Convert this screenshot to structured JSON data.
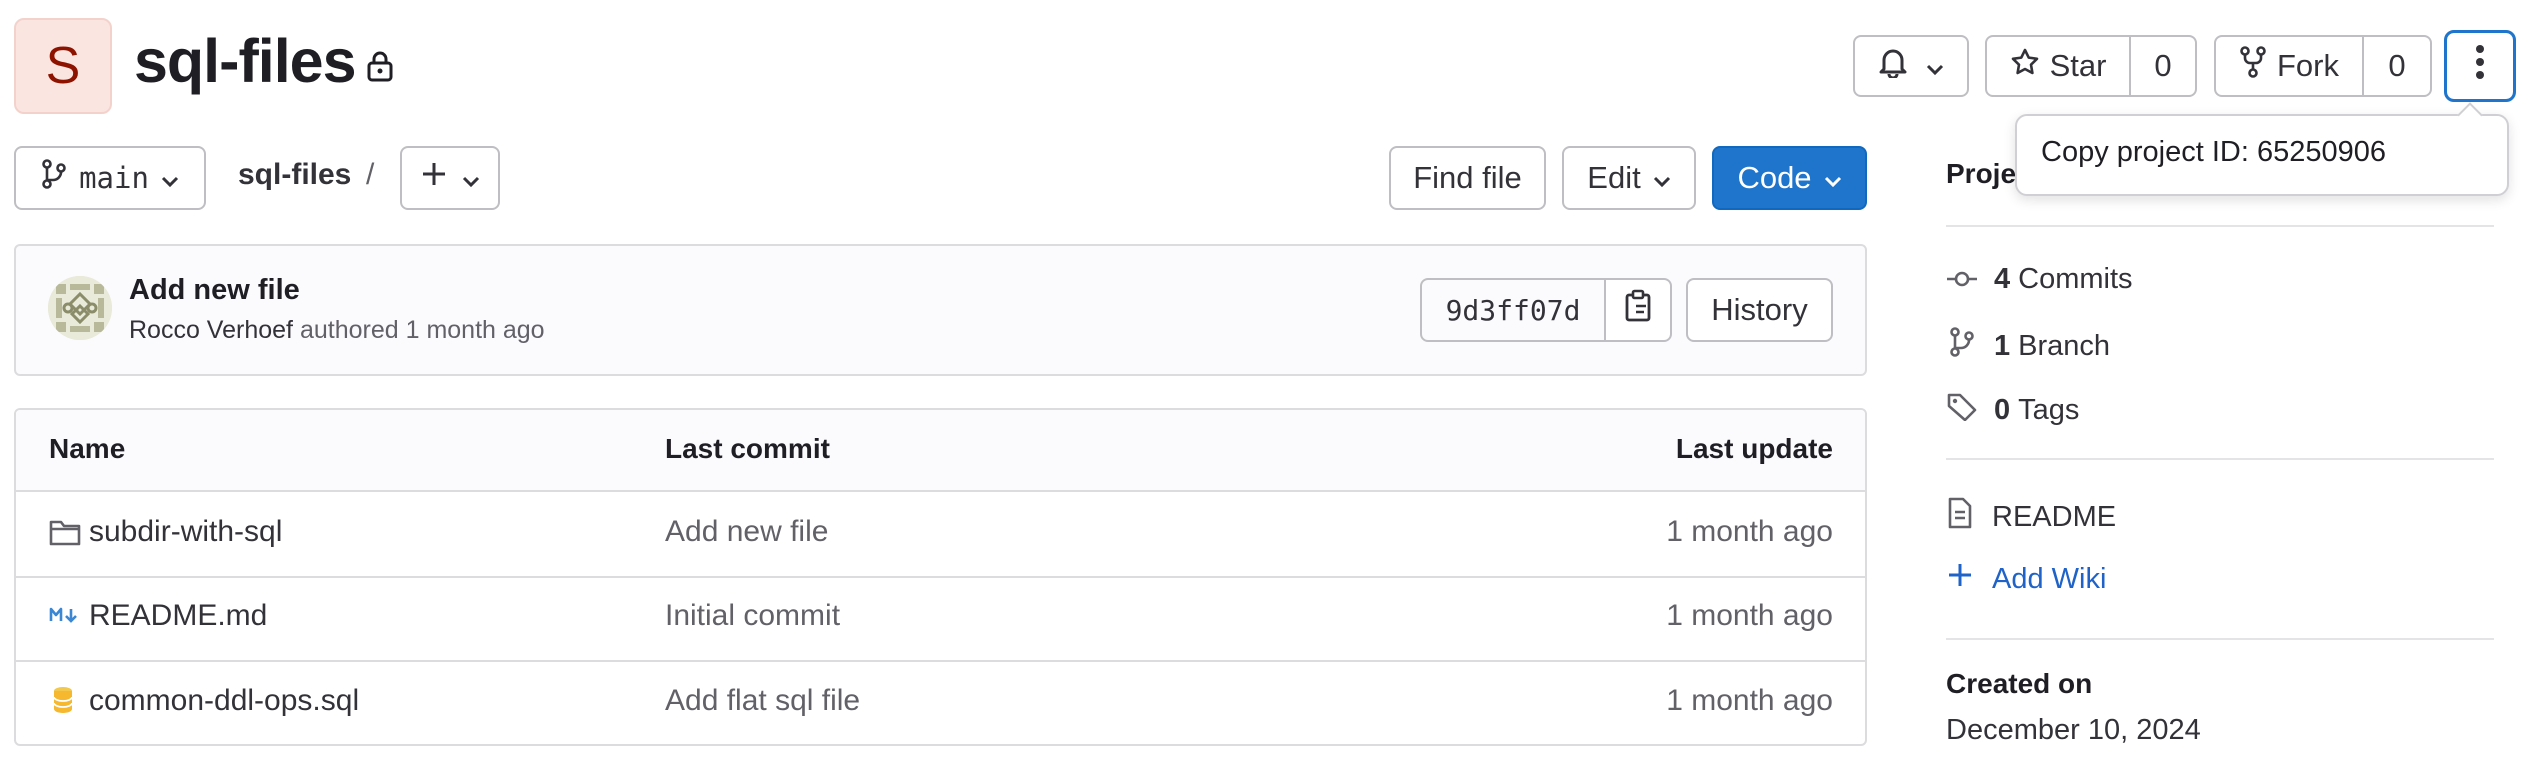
{
  "project": {
    "avatar_letter": "S",
    "name": "sql-files"
  },
  "header": {
    "star_label": "Star",
    "star_count": "0",
    "fork_label": "Fork",
    "fork_count": "0"
  },
  "popover": {
    "copy_project_id": "Copy project ID: 65250906"
  },
  "toolbar": {
    "branch": "main",
    "breadcrumb_project": "sql-files",
    "breadcrumb_sep": "/",
    "find_file": "Find file",
    "edit": "Edit",
    "code": "Code"
  },
  "commit": {
    "title": "Add new file",
    "author": "Rocco Verhoef",
    "authored": "authored 1 month ago",
    "sha": "9d3ff07d",
    "history": "History"
  },
  "table": {
    "headers": [
      "Name",
      "Last commit",
      "Last update"
    ],
    "rows": [
      {
        "icon": "folder-icon",
        "name": "subdir-with-sql",
        "commit": "Add new file",
        "updated": "1 month ago"
      },
      {
        "icon": "markdown-icon",
        "name": "README.md",
        "commit": "Initial commit",
        "updated": "1 month ago"
      },
      {
        "icon": "database-icon",
        "name": "common-ddl-ops.sql",
        "commit": "Add flat sql file",
        "updated": "1 month ago"
      }
    ]
  },
  "sidebar": {
    "heading": "Proje",
    "commits_count": "4",
    "commits_label": "Commits",
    "branch_count": "1",
    "branch_label": "Branch",
    "tags_count": "0",
    "tags_label": "Tags",
    "readme": "README",
    "add_wiki": "Add Wiki",
    "created_label": "Created on",
    "created_date": "December 10, 2024"
  },
  "colors": {
    "primary": "#1f75cb",
    "primary_dark": "#1068bf",
    "link": "#1f63c8",
    "avatar_bg": "#fbe5e1",
    "avatar_fg": "#8d1300"
  }
}
